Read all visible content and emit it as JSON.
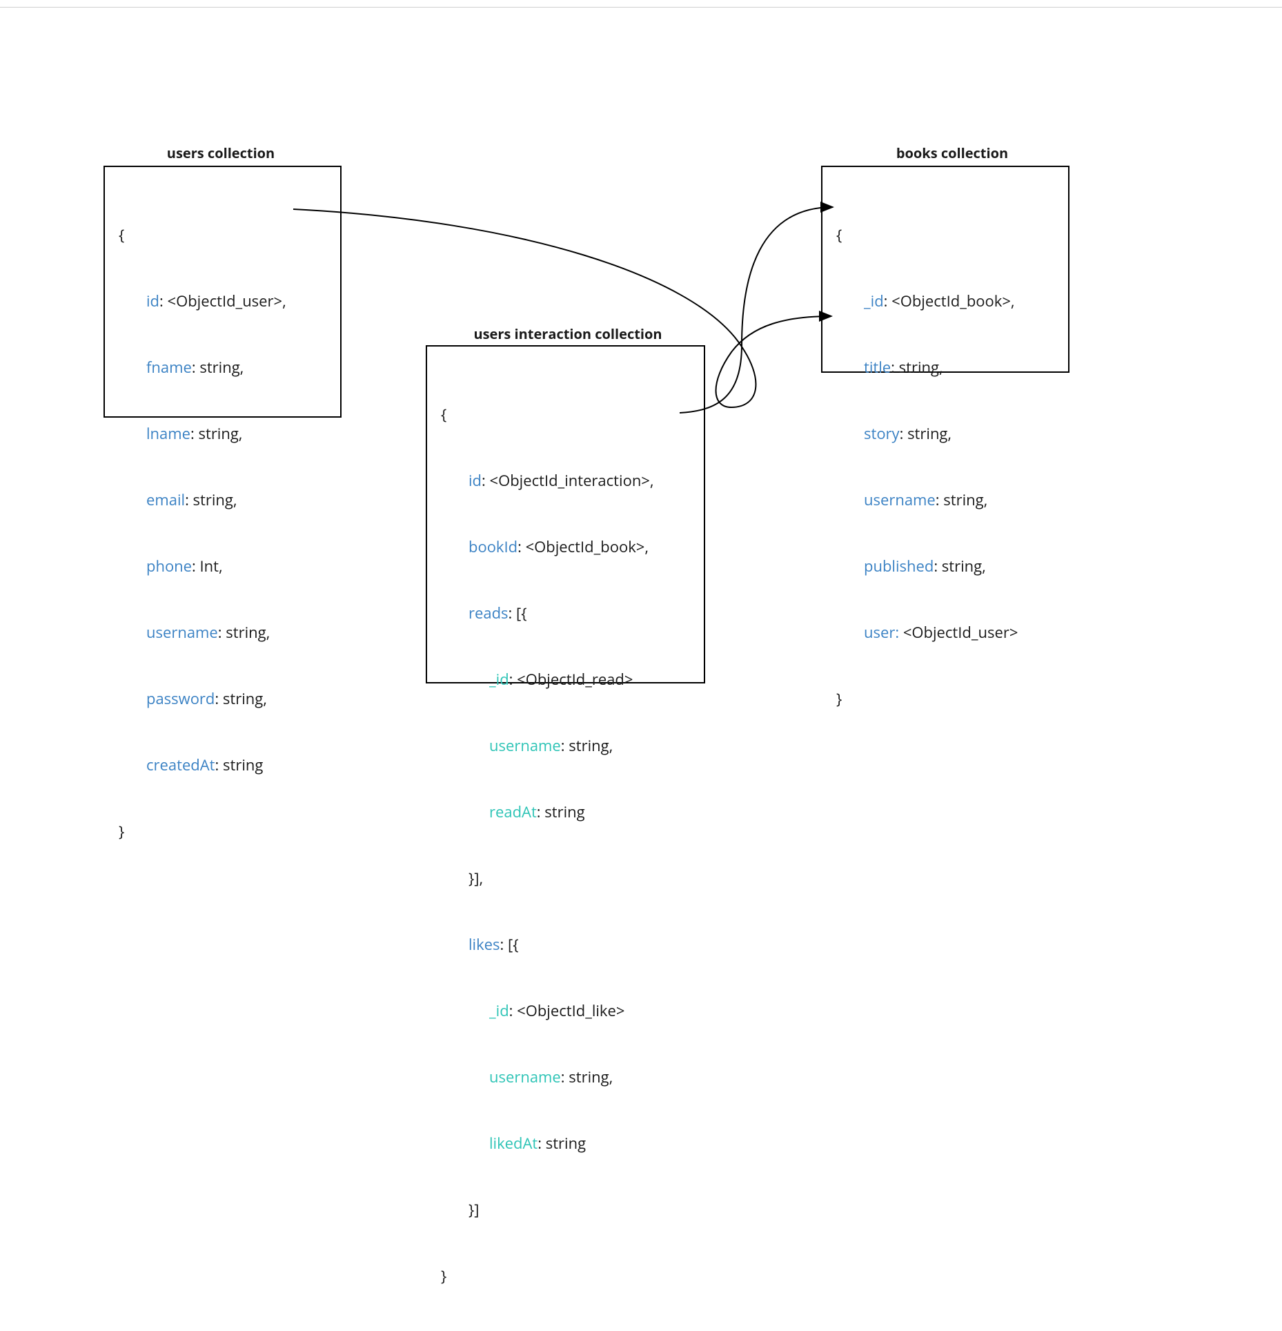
{
  "colors": {
    "key_blue": "#3b82c4",
    "key_teal": "#2ec4b6",
    "text": "#1a1a1a",
    "border": "#000000"
  },
  "titles": {
    "users": "users collection",
    "interaction": "users interaction collection",
    "books": "books collection"
  },
  "users_panel": {
    "open_brace": "{",
    "lines": [
      {
        "key": "id",
        "key_class": "k",
        "value": ": <ObjectId_user>,"
      },
      {
        "key": "fname",
        "key_class": "k",
        "value": ": string,"
      },
      {
        "key": "lname",
        "key_class": "k",
        "value": ": string,"
      },
      {
        "key": "email",
        "key_class": "k",
        "value": ": string,"
      },
      {
        "key": "phone",
        "key_class": "k",
        "value": ": Int,"
      },
      {
        "key": "username",
        "key_class": "k",
        "value": ": string,"
      },
      {
        "key": "password",
        "key_class": "k",
        "value": ": string,"
      },
      {
        "key": "createdAt",
        "key_class": "k",
        "value": ": string"
      }
    ],
    "close_brace": "}"
  },
  "interaction_panel": {
    "open_brace": "{",
    "l0": {
      "key": "id",
      "value": ": <ObjectId_interaction>,"
    },
    "l1": {
      "key": "bookId",
      "value": ": <ObjectId_book>,"
    },
    "l2": {
      "key": "reads",
      "value": ": [{"
    },
    "l3": {
      "key": "_id",
      "value": ": <ObjectId_read>"
    },
    "l4": {
      "key": "username",
      "value": ": string,"
    },
    "l5": {
      "key": "readAt",
      "value": ": string"
    },
    "l6": {
      "text": "}],",
      "class": "v"
    },
    "l7": {
      "key": "likes",
      "value": ": [{"
    },
    "l8": {
      "key": "_id",
      "value": ": <ObjectId_like>"
    },
    "l9": {
      "key": "username",
      "value": ": string,"
    },
    "l10": {
      "key": "likedAt",
      "value": ": string"
    },
    "l11": {
      "text": "}]",
      "class": "v"
    },
    "close_brace": "}"
  },
  "books_panel": {
    "open_brace": "{",
    "lines": [
      {
        "key": "_id",
        "key_class": "k",
        "value": ": <ObjectId_book>,"
      },
      {
        "key": "title",
        "key_class": "k",
        "value": ": string,"
      },
      {
        "key": "story",
        "key_class": "k",
        "value": ": string,"
      },
      {
        "key": "username",
        "key_class": "k",
        "value": ": string,"
      },
      {
        "key": "published",
        "key_class": "k",
        "value": ": string,"
      },
      {
        "key": "user:",
        "key_class": "k",
        "value": " <ObjectId_user>"
      }
    ],
    "close_brace": "}"
  }
}
